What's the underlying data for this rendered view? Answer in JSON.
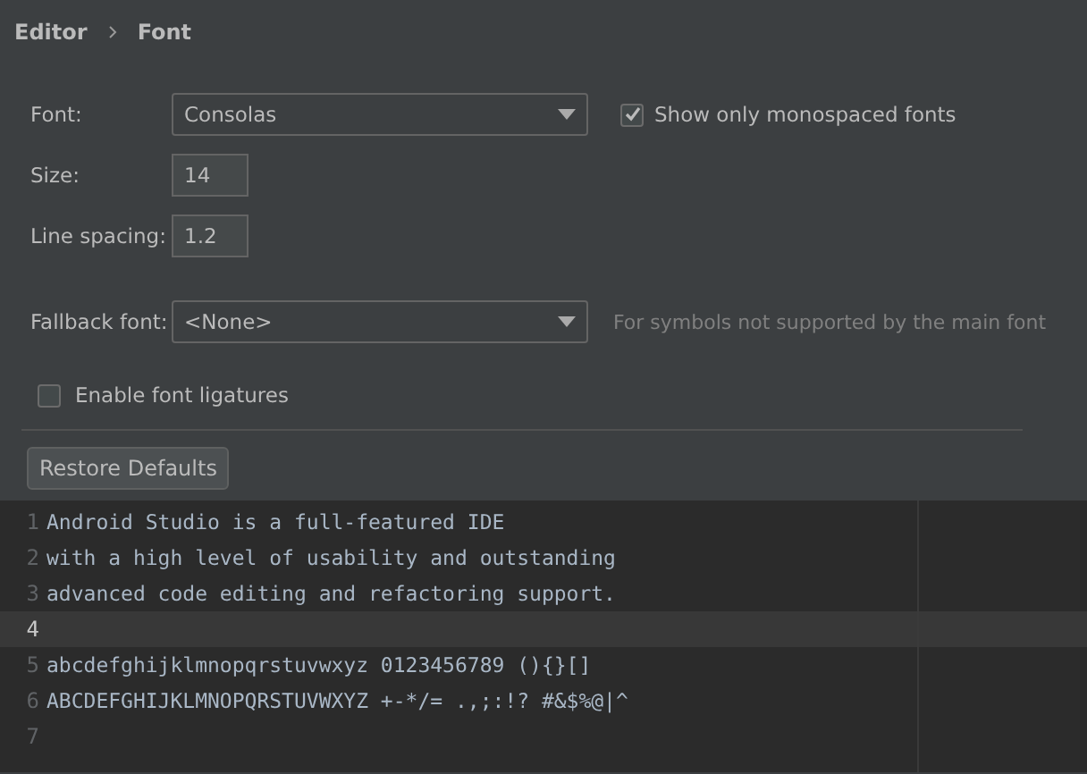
{
  "breadcrumb": [
    "Editor",
    "Font"
  ],
  "font": {
    "label": "Font:",
    "value": "Consolas",
    "monospaced_only": {
      "label": "Show only monospaced fonts",
      "checked": true
    }
  },
  "size": {
    "label": "Size:",
    "value": "14"
  },
  "line_spacing": {
    "label": "Line spacing:",
    "value": "1.2"
  },
  "fallback_font": {
    "label": "Fallback font:",
    "value": "<None>",
    "hint": "For symbols not supported by the main font"
  },
  "ligatures": {
    "label": "Enable font ligatures",
    "checked": false
  },
  "restore_button": "Restore Defaults",
  "preview": {
    "lines": [
      {
        "number": "1",
        "text": "Android Studio is a full-featured IDE",
        "current": false
      },
      {
        "number": "2",
        "text": "with a high level of usability and outstanding",
        "current": false
      },
      {
        "number": "3",
        "text": "advanced code editing and refactoring support.",
        "current": false
      },
      {
        "number": "4",
        "current": true
      },
      {
        "number": "5",
        "text": "abcdefghijklmnopqrstuvwxyz 0123456789 (){}[]",
        "current": false
      },
      {
        "number": "6",
        "text": "ABCDEFGHIJKLMNOPQRSTUVWXYZ +-*/= .,;:!? #&$%@|^",
        "current": false
      },
      {
        "number": "7",
        "current": false
      }
    ]
  }
}
